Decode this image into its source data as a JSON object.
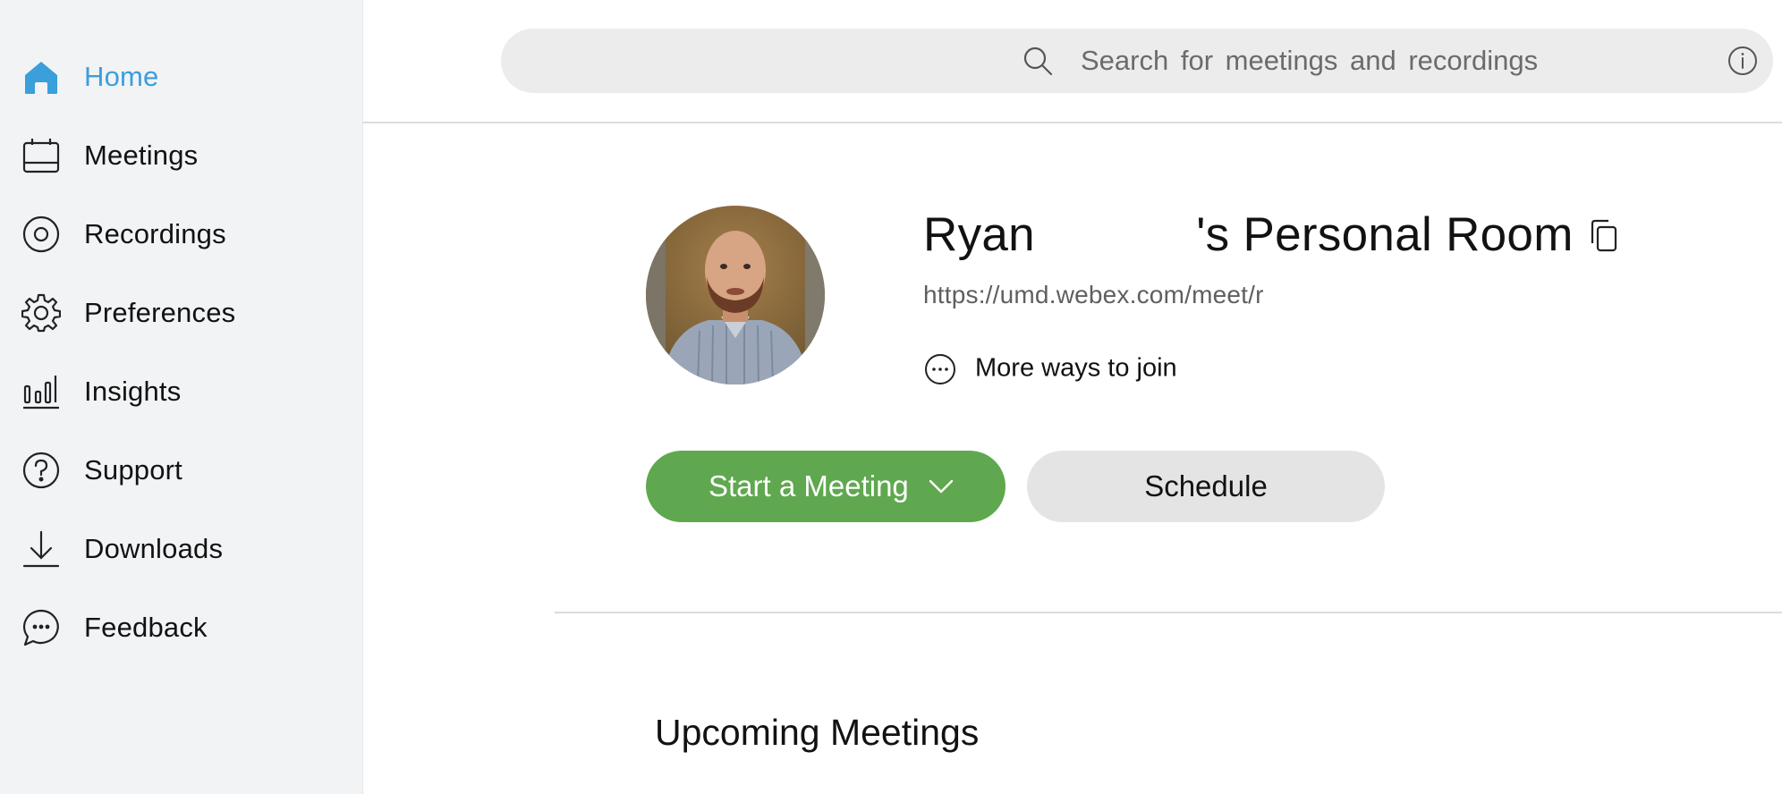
{
  "sidebar": {
    "items": [
      {
        "label": "Home",
        "icon": "home-icon",
        "active": true
      },
      {
        "label": "Meetings",
        "icon": "calendar-icon",
        "active": false
      },
      {
        "label": "Recordings",
        "icon": "recording-icon",
        "active": false
      },
      {
        "label": "Preferences",
        "icon": "gear-icon",
        "active": false
      },
      {
        "label": "Insights",
        "icon": "bar-chart-icon",
        "active": false
      },
      {
        "label": "Support",
        "icon": "help-icon",
        "active": false
      },
      {
        "label": "Downloads",
        "icon": "download-icon",
        "active": false
      },
      {
        "label": "Feedback",
        "icon": "chat-bubble-icon",
        "active": false
      }
    ]
  },
  "search": {
    "placeholder": "Search for meetings and recordings",
    "icon": "search-icon",
    "info_icon": "info-icon"
  },
  "room": {
    "title": "Ryan            's Personal Room",
    "url": "https://umd.webex.com/meet/r",
    "copy_icon": "copy-icon",
    "more_ways_label": "More ways to join",
    "more_ways_icon": "more-options-icon"
  },
  "actions": {
    "start_label": "Start a Meeting",
    "schedule_label": "Schedule"
  },
  "sections": {
    "upcoming_title": "Upcoming Meetings"
  },
  "colors": {
    "accent": "#3a9fdb",
    "start_button": "#5fa84f",
    "sidebar_bg": "#f2f3f5",
    "schedule_button": "#e4e4e4"
  }
}
